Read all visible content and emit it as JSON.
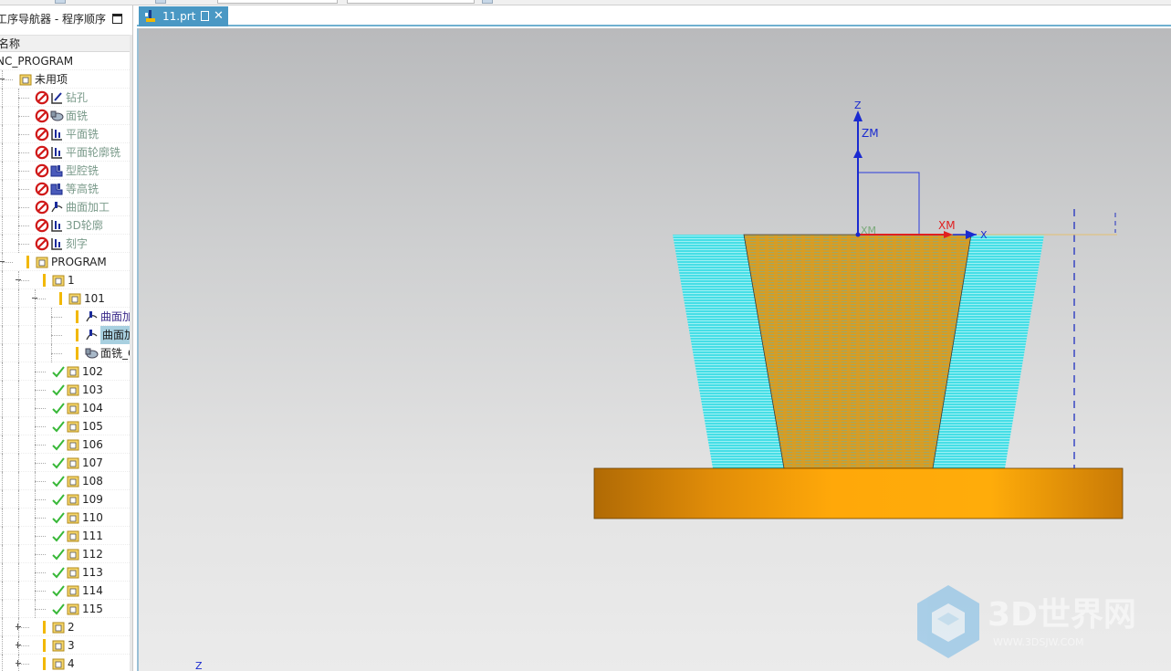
{
  "navigator": {
    "title": "工序导航器 - 程序顺序",
    "column_header": "名称",
    "rows": [
      {
        "label": "NC_PROGRAM"
      },
      {
        "label": "未用项"
      },
      {
        "label": "钻孔"
      },
      {
        "label": "面铣"
      },
      {
        "label": "平面铣"
      },
      {
        "label": "平面轮廓铣"
      },
      {
        "label": "型腔铣"
      },
      {
        "label": "等高铣"
      },
      {
        "label": "曲面加工"
      },
      {
        "label": "3D轮廓"
      },
      {
        "label": "刻字"
      },
      {
        "label": "PROGRAM"
      },
      {
        "label": "1"
      },
      {
        "label": "101"
      },
      {
        "label": "曲面加工"
      },
      {
        "label": "曲面加工"
      },
      {
        "label": "面铣_C"
      },
      {
        "label": "102"
      },
      {
        "label": "103"
      },
      {
        "label": "104"
      },
      {
        "label": "105"
      },
      {
        "label": "106"
      },
      {
        "label": "107"
      },
      {
        "label": "108"
      },
      {
        "label": "109"
      },
      {
        "label": "110"
      },
      {
        "label": "111"
      },
      {
        "label": "112"
      },
      {
        "label": "113"
      },
      {
        "label": "114"
      },
      {
        "label": "115"
      },
      {
        "label": "2"
      },
      {
        "label": "3"
      },
      {
        "label": "4"
      }
    ]
  },
  "tab": {
    "filename": "11.prt"
  },
  "viewport": {
    "axis_labels": {
      "z": "Z",
      "zm": "ZM",
      "xm_left": "XM",
      "xm": "XM",
      "x": "X",
      "corner_z": "Z"
    }
  },
  "watermark": {
    "brand": "3D世界网",
    "url": "WWW.3DSJW.COM"
  },
  "colors": {
    "toolpath_cyan": "#3fe6ec",
    "toolpath_orange": "#d79a1c",
    "stock_orange": "#f7a40b",
    "tab_blue": "#4a98c4",
    "check_green": "#38b838",
    "no_entry_red": "#d01818",
    "folder_yellow": "#f2c94c"
  }
}
